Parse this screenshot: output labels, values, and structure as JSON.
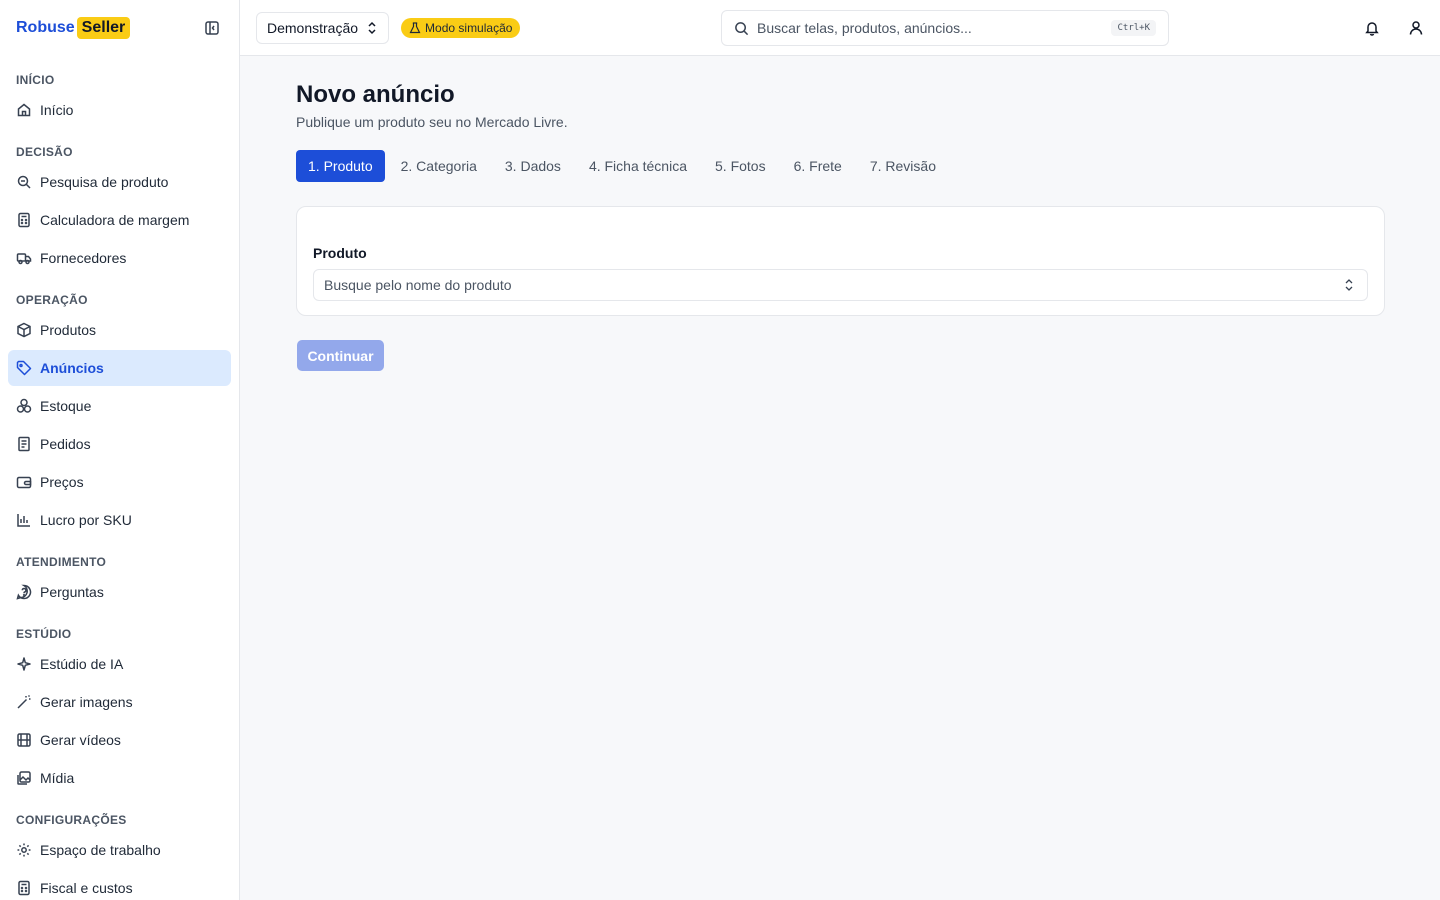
{
  "brand": {
    "name": "Robuse",
    "badge": "Seller"
  },
  "sidebar": {
    "sections": [
      {
        "title": "INÍCIO",
        "items": [
          {
            "label": "Início",
            "icon": "home-icon"
          }
        ]
      },
      {
        "title": "DECISÃO",
        "items": [
          {
            "label": "Pesquisa de produto",
            "icon": "search-zoom-icon"
          },
          {
            "label": "Calculadora de margem",
            "icon": "calculator-icon"
          },
          {
            "label": "Fornecedores",
            "icon": "truck-icon"
          }
        ]
      },
      {
        "title": "OPERAÇÃO",
        "items": [
          {
            "label": "Produtos",
            "icon": "package-icon"
          },
          {
            "label": "Anúncios",
            "icon": "tag-icon",
            "active": true
          },
          {
            "label": "Estoque",
            "icon": "boxes-icon"
          },
          {
            "label": "Pedidos",
            "icon": "receipt-icon"
          },
          {
            "label": "Preços",
            "icon": "wallet-icon"
          },
          {
            "label": "Lucro por SKU",
            "icon": "bar-chart-icon"
          }
        ]
      },
      {
        "title": "ATENDIMENTO",
        "items": [
          {
            "label": "Perguntas",
            "icon": "question-bubble-icon"
          }
        ]
      },
      {
        "title": "ESTÚDIO",
        "items": [
          {
            "label": "Estúdio de IA",
            "icon": "sparkles-icon"
          },
          {
            "label": "Gerar imagens",
            "icon": "magic-wand-icon"
          },
          {
            "label": "Gerar vídeos",
            "icon": "film-icon"
          },
          {
            "label": "Mídia",
            "icon": "images-icon"
          }
        ]
      },
      {
        "title": "CONFIGURAÇÕES",
        "items": [
          {
            "label": "Espaço de trabalho",
            "icon": "gear-icon"
          },
          {
            "label": "Fiscal e custos",
            "icon": "calculator-icon"
          }
        ]
      }
    ]
  },
  "topbar": {
    "workspace": "Demonstração",
    "sim_badge": "Modo simulação",
    "search_placeholder": "Buscar telas, produtos, anúncios...",
    "search_shortcut": "Ctrl+K"
  },
  "page": {
    "title": "Novo anúncio",
    "subtitle": "Publique um produto seu no Mercado Livre.",
    "steps": [
      "1. Produto",
      "2. Categoria",
      "3. Dados",
      "4. Ficha técnica",
      "5. Fotos",
      "6. Frete",
      "7. Revisão"
    ],
    "active_step": 0,
    "field_label": "Produto",
    "field_placeholder": "Busque pelo nome do produto",
    "continue_label": "Continuar"
  },
  "colors": {
    "accent": "#1d4ed8",
    "active_bg": "#dbeafe",
    "badge": "#facc15",
    "disabled_button": "#93a8eb"
  }
}
